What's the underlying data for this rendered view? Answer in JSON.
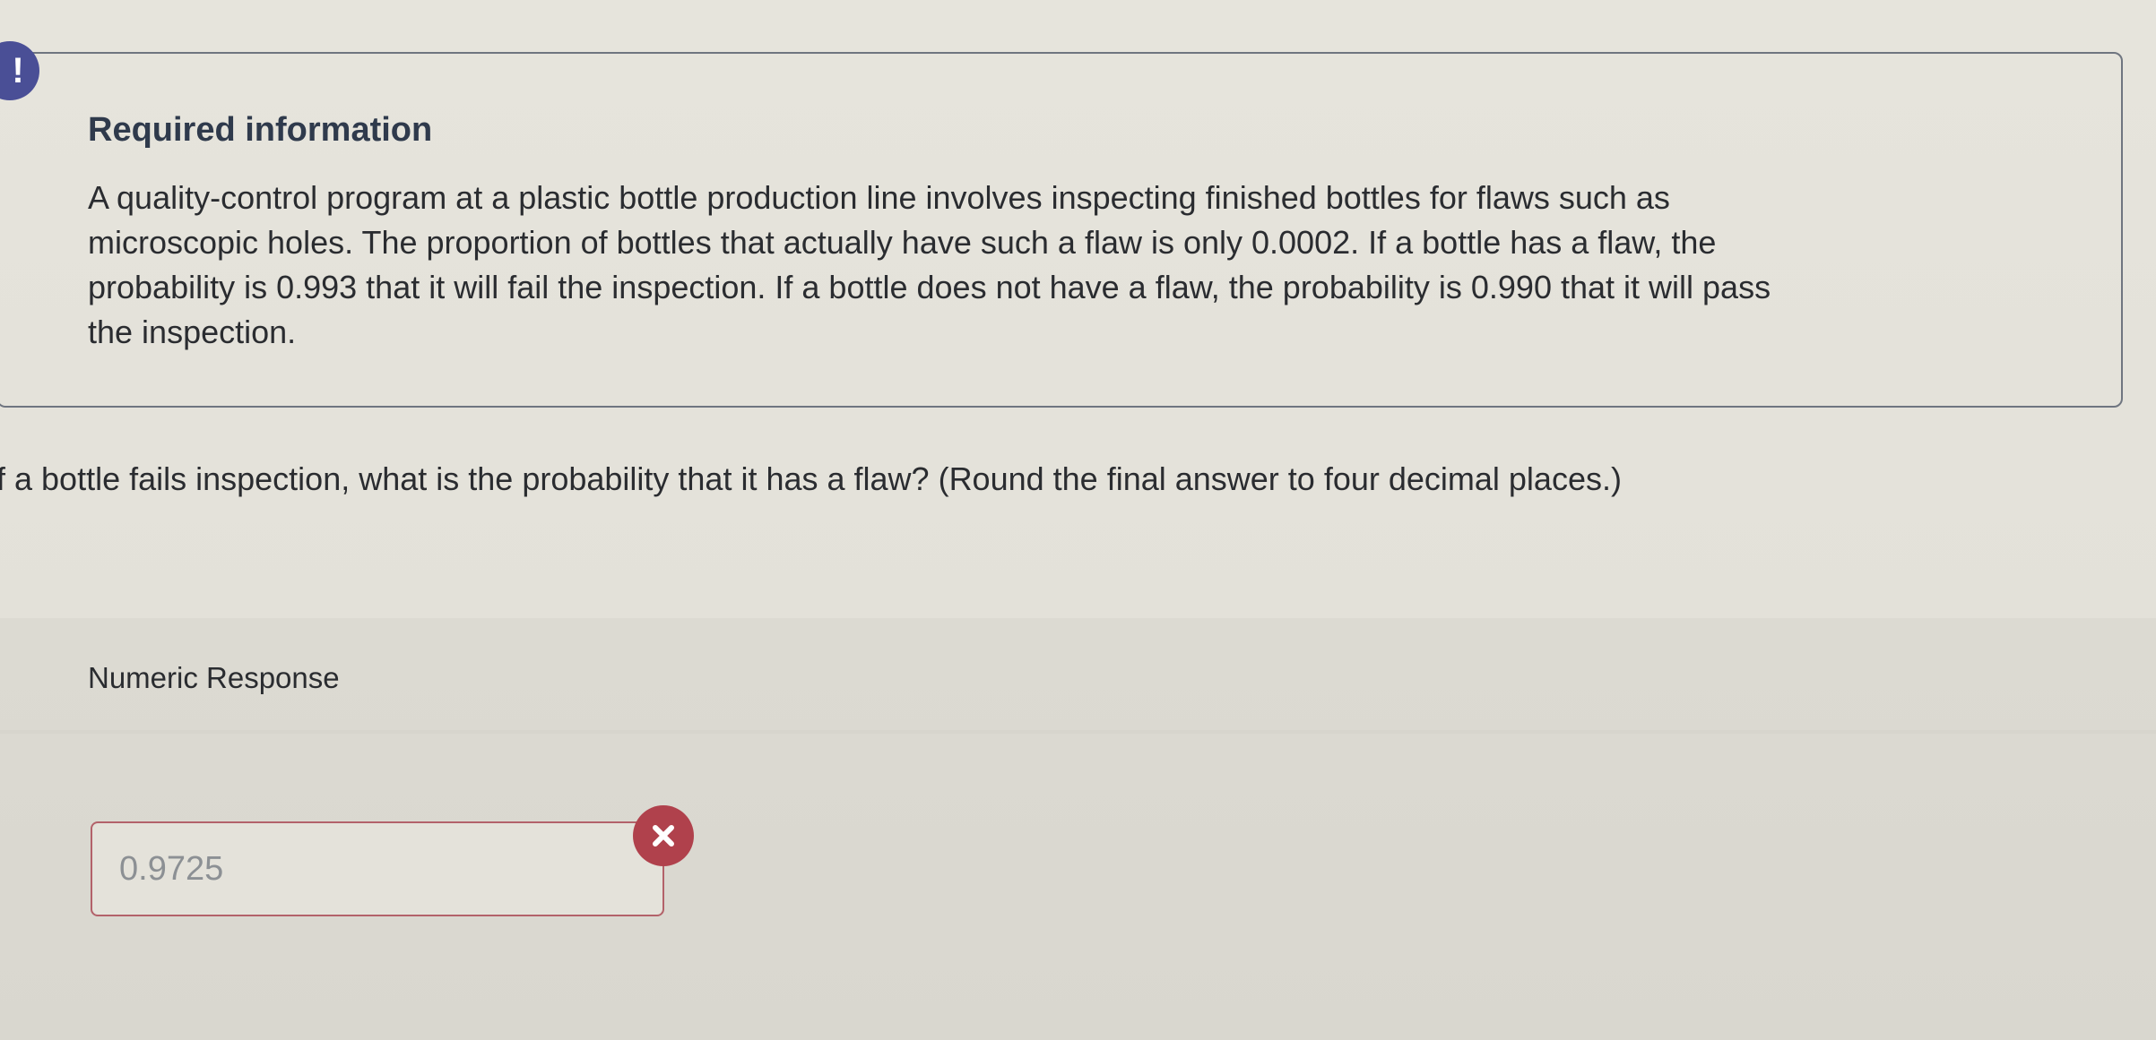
{
  "alert": {
    "symbol": "!",
    "color": "#4a4f96"
  },
  "info": {
    "title": "Required information",
    "lines": [
      "A quality-control program at a plastic bottle production line involves inspecting finished bottles for flaws such as",
      "microscopic holes. The proportion of bottles that actually have such a flaw is only 0.0002. If a bottle has a flaw, the",
      "probability is 0.993 that it will fail the inspection. If a bottle does not have a flaw, the probability is 0.990 that it will pass",
      "the inspection."
    ]
  },
  "question": {
    "text": "f a bottle fails inspection, what is the probability that it has a flaw? (Round the final answer to four decimal places.)"
  },
  "response": {
    "label": "Numeric Response",
    "value": "0.9725",
    "status": "incorrect",
    "status_icon": "x-mark-icon",
    "status_color": "#b0414c"
  }
}
